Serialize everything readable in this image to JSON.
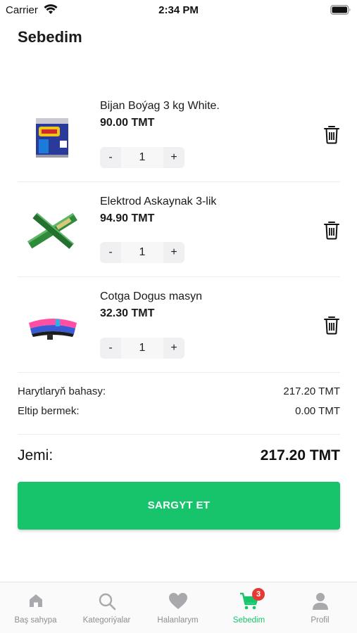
{
  "status_bar": {
    "carrier": "Carrier",
    "time": "2:34 PM"
  },
  "page": {
    "title": "Sebedim"
  },
  "items": [
    {
      "name": "Bijan Boýag 3 kg White.",
      "price": "90.00 TMT",
      "quantity": "1",
      "minus": "-",
      "plus": "+",
      "thumb": "paint-can"
    },
    {
      "name": "Elektrod Askaynak 3-lik",
      "price": "94.90 TMT",
      "quantity": "1",
      "minus": "-",
      "plus": "+",
      "thumb": "electrode-pack"
    },
    {
      "name": "Cotga Dogus masyn",
      "price": "32.30 TMT",
      "quantity": "1",
      "minus": "-",
      "plus": "+",
      "thumb": "car-brush"
    }
  ],
  "summary": {
    "subtotal_label": "Harytlaryň bahasy:",
    "subtotal_value": "217.20 TMT",
    "delivery_label": "Eltip bermek:",
    "delivery_value": "0.00 TMT",
    "total_label": "Jemi:",
    "total_value": "217.20 TMT"
  },
  "checkout": {
    "label": "SARGYT ET",
    "color": "#17c46b"
  },
  "tabs": [
    {
      "label": "Baş sahypa",
      "icon": "home-icon",
      "active": false
    },
    {
      "label": "Kategoriýalar",
      "icon": "search-icon",
      "active": false
    },
    {
      "label": "Halanlarym",
      "icon": "heart-icon",
      "active": false
    },
    {
      "label": "Sebedim",
      "icon": "cart-icon",
      "active": true,
      "badge": "3"
    },
    {
      "label": "Profil",
      "icon": "user-icon",
      "active": false
    }
  ],
  "colors": {
    "accent": "#17c46b",
    "badge": "#e53935",
    "inactive_tab": "#8e8e8e"
  }
}
